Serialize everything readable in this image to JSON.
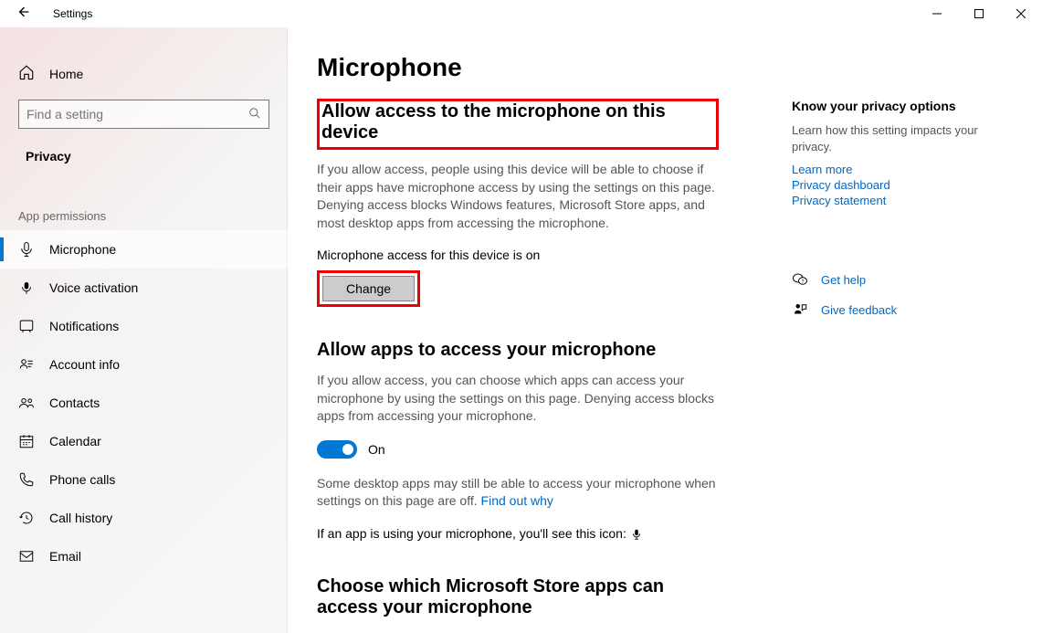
{
  "window": {
    "title": "Settings"
  },
  "sidebar": {
    "home": "Home",
    "search_placeholder": "Find a setting",
    "section": "Privacy",
    "group": "App permissions",
    "items": [
      {
        "label": "Microphone"
      },
      {
        "label": "Voice activation"
      },
      {
        "label": "Notifications"
      },
      {
        "label": "Account info"
      },
      {
        "label": "Contacts"
      },
      {
        "label": "Calendar"
      },
      {
        "label": "Phone calls"
      },
      {
        "label": "Call history"
      },
      {
        "label": "Email"
      }
    ]
  },
  "main": {
    "page_title": "Microphone",
    "h1": "Allow access to the microphone on this device",
    "p1": "If you allow access, people using this device will be able to choose if their apps have microphone access by using the settings on this page. Denying access blocks Windows features, Microsoft Store apps, and most desktop apps from accessing the microphone.",
    "status": "Microphone access for this device is on",
    "change": "Change",
    "h2": "Allow apps to access your microphone",
    "p2": "If you allow access, you can choose which apps can access your microphone by using the settings on this page. Denying access blocks apps from accessing your microphone.",
    "toggle_label": "On",
    "p3": "Some desktop apps may still be able to access your microphone when settings on this page are off. ",
    "find_out": "Find out why",
    "p4": "If an app is using your microphone, you'll see this icon: ",
    "h3": "Choose which Microsoft Store apps can access your microphone"
  },
  "side": {
    "h": "Know your privacy options",
    "p": "Learn how this setting impacts your privacy.",
    "links": [
      "Learn more",
      "Privacy dashboard",
      "Privacy statement"
    ],
    "help": "Get help",
    "feedback": "Give feedback"
  }
}
